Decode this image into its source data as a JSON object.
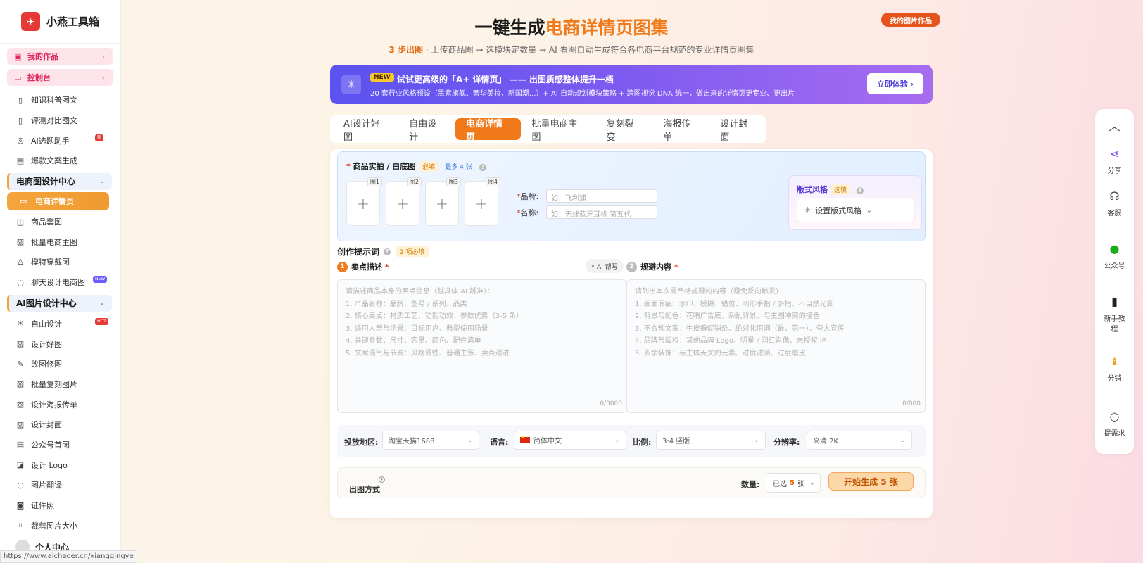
{
  "app": {
    "name": "小燕工具箱"
  },
  "sidebar": {
    "pills": [
      {
        "label": "我的作品"
      },
      {
        "label": "控制台"
      }
    ],
    "group0": [
      {
        "label": "知识科普图文"
      },
      {
        "label": "评测对比图文"
      },
      {
        "label": "AI选题助手",
        "badge": "新"
      },
      {
        "label": "爆款文案生成"
      }
    ],
    "section1": "电商图设计中心",
    "active": "电商详情页",
    "group1": [
      {
        "label": "商品套图"
      },
      {
        "label": "批量电商主图"
      },
      {
        "label": "模特穿戴图"
      },
      {
        "label": "聊天设计电商图",
        "badge": "NEW"
      }
    ],
    "section2": "AI图片设计中心",
    "group2": [
      {
        "label": "自由设计",
        "badge": "HOT"
      },
      {
        "label": "设计好图"
      },
      {
        "label": "改图修图"
      },
      {
        "label": "批量复刻图片"
      },
      {
        "label": "设计海报传单"
      },
      {
        "label": "设计封面"
      },
      {
        "label": "公众号首图"
      },
      {
        "label": "设计 Logo"
      },
      {
        "label": "图片翻译"
      },
      {
        "label": "证件照"
      },
      {
        "label": "裁剪图片大小"
      }
    ],
    "user": "个人中心",
    "status_url": "https://www.aichaoer.cn/xiangqingye"
  },
  "header": {
    "title_main": "一键生成",
    "title_highlight": "电商详情页图集",
    "subtitle_highlight": "3 步出图",
    "subtitle_rest": " · 上传商品图 → 选模块定数量 → AI 看图自动生成符合各电商平台规范的专业详情页图集",
    "my_works": "我的图片作品"
  },
  "banner": {
    "tag": "NEW",
    "title": "试试更高级的「A+ 详情页」 —— 出图质感整体提升一档",
    "desc": "20 套行业风格预设（黑紫旗舰、奢华美妆、新国潮...）+ AI 自动规划模块策略 + 跨图视觉 DNA 统一，做出来的详情页更专业、更出片",
    "button": "立即体验"
  },
  "tabs": [
    "AI设计好图",
    "自由设计",
    "电商详情页",
    "批量电商主图",
    "复刻裂变",
    "海报传单",
    "设计封面"
  ],
  "active_tab_index": 2,
  "upload": {
    "label": "商品实拍 / 白底图",
    "required_tag": "必填",
    "max_tag": "最多 4 张",
    "slots": [
      "图1",
      "图2",
      "图3",
      "图4"
    ],
    "brand_label": "品牌:",
    "brand_placeholder": "如：飞利浦",
    "name_label": "名称:",
    "name_placeholder": "如：无线蓝牙耳机 第五代"
  },
  "style": {
    "title": "版式风格",
    "tag": "选填",
    "select": "设置版式风格"
  },
  "prompt": {
    "title": "创作提示词",
    "tag": "2 项必填",
    "col1_num": "1",
    "col1_title": "卖点描述",
    "ai_help": "AI 帮写",
    "col1_placeholder": [
      "请描述商品本身的卖点信息（越具体 AI 越准）：",
      "1. 产品名称：品牌、型号 / 系列、品类",
      "2. 核心卖点：材质工艺、功能功效、参数优势（3-5 条）",
      "3. 适用人群与场景：目标用户、典型使用场景",
      "4. 关键参数：尺寸、容量、颜色、配件清单",
      "5. 文案语气与节奏：风格调性、普通主张、卖点递进"
    ],
    "col1_counter": "0/3000",
    "col2_num": "2",
    "col2_title": "规避内容",
    "col2_placeholder": [
      "请列出本次需严格规避的内容（避免反向触发）：",
      "1. 画面瑕疵：水印、模糊、错位、畸形手指 / 多指、不自然光影",
      "2. 背景与配色：花哨广告底、杂乱背景、与主图冲突的撞色",
      "3. 不合规文案：牛皮癣促销条、绝对化用词（最、第一）、夸大宣传",
      "4. 品牌与版权：其他品牌 Logo、明星 / 网红肖像、未授权 IP",
      "5. 多余装饰：与主体无关的元素、过度滤镜、过度磨皮"
    ],
    "col2_counter": "0/800"
  },
  "settings": {
    "region_label": "投放地区:",
    "region": "淘宝天猫1688",
    "lang_label": "语言:",
    "lang": "简体中文",
    "ratio_label": "比例:",
    "ratio": "3:4 竖版",
    "res_label": "分辨率:",
    "res": "高清 2K"
  },
  "output": {
    "label": "出图方式",
    "qty_label": "数量:",
    "qty_prefix": "已选",
    "qty_num": "5",
    "qty_unit": "张",
    "generate": "开始生成 5 张"
  },
  "rail": [
    "分享",
    "客服",
    "公众号",
    "新手教程",
    "分销",
    "提需求"
  ],
  "colors": {
    "accent": "#f07a1a",
    "brand": "#e53935",
    "banner": "#6a55f0"
  }
}
